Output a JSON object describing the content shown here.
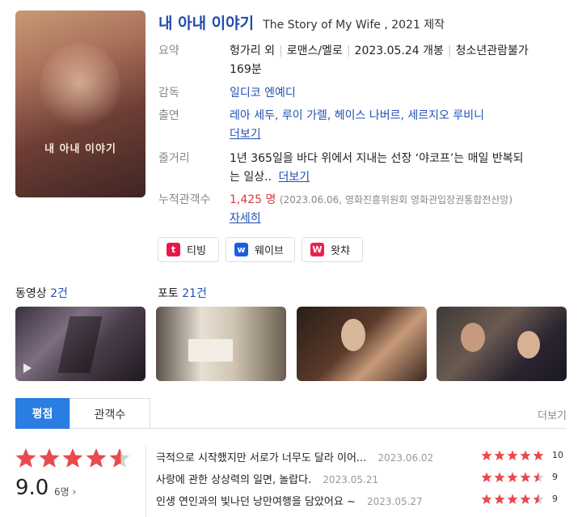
{
  "movie": {
    "title_ko": "내 아내 이야기",
    "title_en": "The Story of My Wife , 2021 제작",
    "poster_title": "내 아내 이야기"
  },
  "info": {
    "summary_label": "요약",
    "summary_parts": [
      "헝가리 외",
      "로맨스/멜로",
      "2023.05.24 개봉",
      "청소년관람불가"
    ],
    "runtime": "169분",
    "director_label": "감독",
    "director": "일디코 엔예디",
    "cast_label": "출연",
    "cast": "레아 세두, 루이 가렐, 헤이스 나버르, 세르지오 루비니",
    "cast_more": "더보기",
    "plot_label": "줄거리",
    "plot_line1": "1년 365일을 바다 위에서 지내는 선장 ‘야코프’는 매일 반복되",
    "plot_line2": "는 일상..",
    "plot_more": "더보기",
    "audience_label": "누적관객수",
    "audience_count": "1,425 명",
    "audience_source": "(2023.06.06, 영화진흥위원회 영화관입장권통합전산망)",
    "audience_detail": "자세히"
  },
  "ott": [
    {
      "label": "티빙",
      "logo": "t",
      "color": "#e8174a"
    },
    {
      "label": "웨이브",
      "logo": "w",
      "color": "#1c5fe0"
    },
    {
      "label": "왓챠",
      "logo": "W",
      "color": "#ea1f4e"
    }
  ],
  "media": {
    "video_label": "동영상",
    "video_count": "2건",
    "photo_label": "포토",
    "photo_count": "21건"
  },
  "tabs": {
    "rating": "평점",
    "audience": "관객수",
    "more": "더보기"
  },
  "rating": {
    "score": "9.0",
    "people": "6명",
    "stars": 4.5
  },
  "reviews": [
    {
      "text": "극적으로 시작했지만 서로가 너무도 달라 이어...",
      "date": "2023.06.02",
      "score": "10",
      "stars": 5
    },
    {
      "text": "사랑에 관한 상상력의 일면, 놀랍다.",
      "date": "2023.05.21",
      "score": "9",
      "stars": 4.5
    },
    {
      "text": "인생 연인과의 빛나던 낭만여행을 담았어요 ~",
      "date": "2023.05.27",
      "score": "9",
      "stars": 4.5
    }
  ],
  "colors": {
    "accent": "#2a7de1",
    "link": "#2050b8",
    "star": "#e84a4e",
    "count": "#e0393e"
  }
}
